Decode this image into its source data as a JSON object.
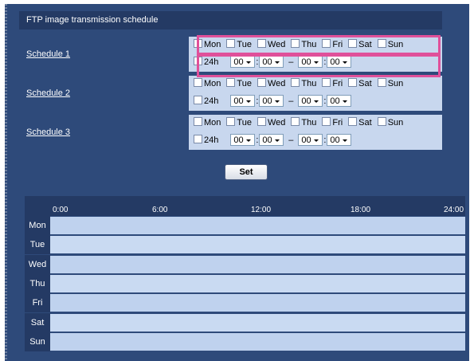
{
  "title": "FTP image transmission schedule",
  "days": [
    "Mon",
    "Tue",
    "Wed",
    "Thu",
    "Fri",
    "Sat",
    "Sun"
  ],
  "all_day_label": "24h",
  "schedules": [
    {
      "label": "Schedule 1",
      "start_hour": "00",
      "start_min": "00",
      "end_hour": "00",
      "end_min": "00"
    },
    {
      "label": "Schedule 2",
      "start_hour": "00",
      "start_min": "00",
      "end_hour": "00",
      "end_min": "00"
    },
    {
      "label": "Schedule 3",
      "start_hour": "00",
      "start_min": "00",
      "end_hour": "00",
      "end_min": "00"
    }
  ],
  "time_separator": ":",
  "range_separator": "–",
  "set_button": "Set",
  "timeline": {
    "ticks": [
      "0:00",
      "6:00",
      "12:00",
      "18:00",
      "24:00"
    ],
    "rows": [
      "Mon",
      "Tue",
      "Wed",
      "Thu",
      "Fri",
      "Sat",
      "Sun"
    ]
  },
  "colors": {
    "highlight": "#e0509a",
    "panel": "#2e4a7a",
    "cell": "#c8d7ee"
  }
}
